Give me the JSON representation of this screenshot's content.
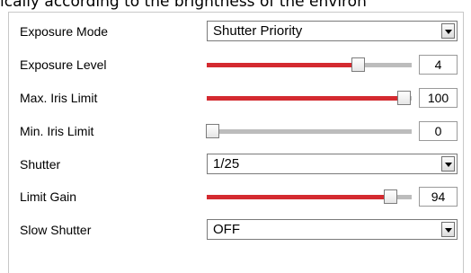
{
  "top_text": "ically according to the brightness of the environ",
  "exposure_mode": {
    "label": "Exposure Mode",
    "value": "Shutter Priority"
  },
  "exposure_level": {
    "label": "Exposure Level",
    "value": "4",
    "fill_fraction": 0.74
  },
  "max_iris_limit": {
    "label": "Max. Iris Limit",
    "value": "100",
    "fill_fraction": 0.965
  },
  "min_iris_limit": {
    "label": "Min. Iris Limit",
    "value": "0",
    "fill_fraction": 0.03
  },
  "shutter": {
    "label": "Shutter",
    "value": "1/25"
  },
  "limit_gain": {
    "label": "Limit Gain",
    "value": "94",
    "fill_fraction": 0.9
  },
  "slow_shutter": {
    "label": "Slow Shutter",
    "value": "OFF"
  },
  "colors": {
    "slider_fill": "#d42a30",
    "slider_track": "#bcbcbc",
    "border": "#c8c8c8"
  },
  "icons": {
    "dropdown": "chevron-down-icon"
  }
}
